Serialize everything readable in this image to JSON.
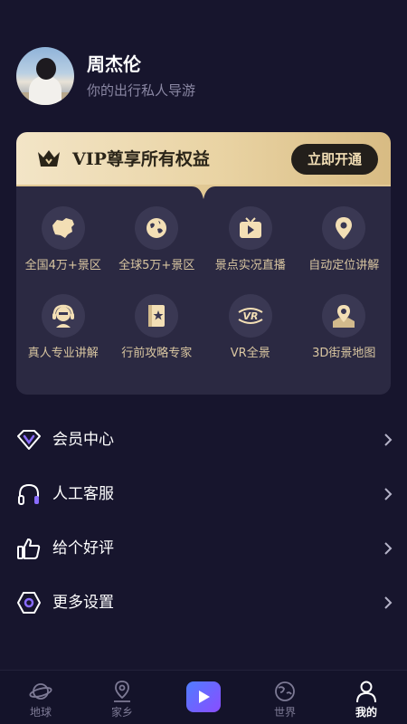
{
  "profile": {
    "name": "周杰伦",
    "subtitle": "你的出行私人导游"
  },
  "vip": {
    "title": "VIP尊享所有权益",
    "button": "立即开通",
    "features": [
      {
        "label": "全国4万+景区",
        "icon": "china-map-icon"
      },
      {
        "label": "全球5万+景区",
        "icon": "globe-icon"
      },
      {
        "label": "景点实况直播",
        "icon": "tv-play-icon"
      },
      {
        "label": "自动定位讲解",
        "icon": "location-pin-icon"
      },
      {
        "label": "真人专业讲解",
        "icon": "headset-person-icon"
      },
      {
        "label": "行前攻略专家",
        "icon": "guide-book-icon"
      },
      {
        "label": "VR全景",
        "icon": "vr-icon"
      },
      {
        "label": "3D街景地图",
        "icon": "map-pin-icon"
      }
    ]
  },
  "menu": [
    {
      "label": "会员中心",
      "icon": "vip-diamond-icon"
    },
    {
      "label": "人工客服",
      "icon": "headphones-icon"
    },
    {
      "label": "给个好评",
      "icon": "thumbs-up-icon"
    },
    {
      "label": "更多设置",
      "icon": "settings-hex-icon"
    }
  ],
  "tabs": [
    {
      "label": "地球",
      "icon": "planet-icon",
      "active": false
    },
    {
      "label": "家乡",
      "icon": "home-pin-icon",
      "active": false
    },
    {
      "label": "",
      "icon": "live-play-icon",
      "active": false
    },
    {
      "label": "世界",
      "icon": "world-icon",
      "active": false
    },
    {
      "label": "我的",
      "icon": "user-icon",
      "active": true
    }
  ],
  "colors": {
    "background": "#17152d",
    "card": "#2b2942",
    "gold": "#d9c6a1",
    "banner": "#e9d3a3"
  }
}
